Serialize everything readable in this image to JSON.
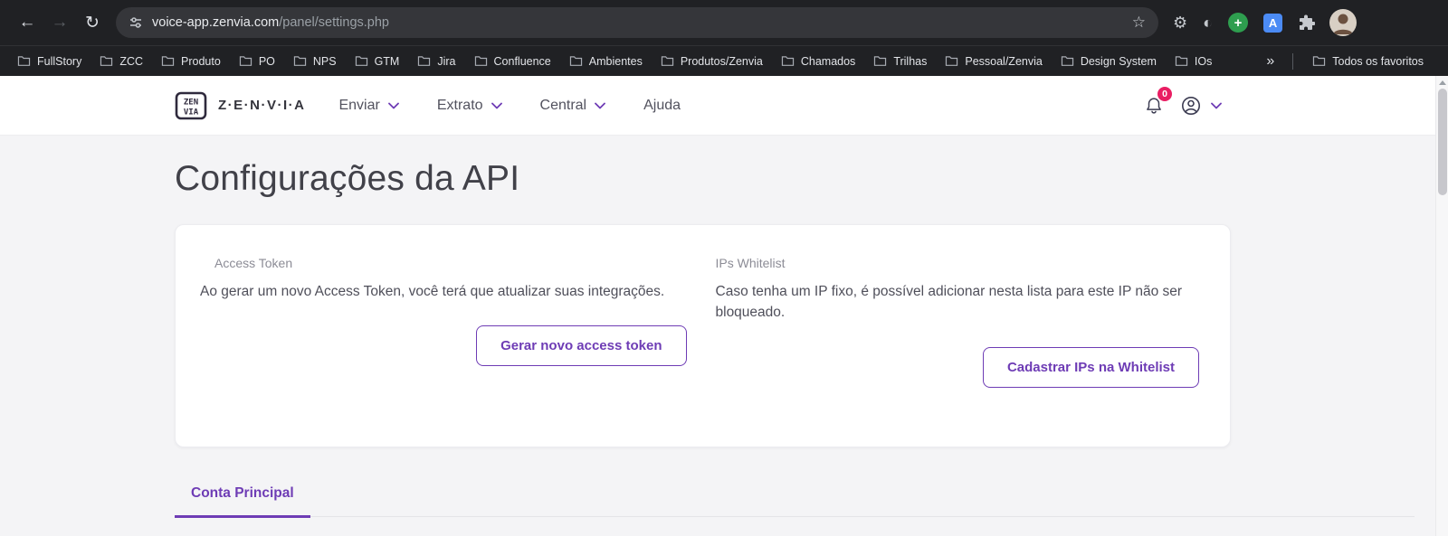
{
  "icons": {
    "back": "←",
    "forward": "→",
    "reload": "↻",
    "star": "☆",
    "gear": "⚙",
    "theme_toggle": "◐",
    "add": "+",
    "translate": "A",
    "overflow": "»"
  },
  "browser": {
    "address": {
      "host": "voice-app.zenvia.com",
      "path": "/panel/settings.php"
    },
    "bookmarks": [
      "FullStory",
      "ZCC",
      "Produto",
      "PO",
      "NPS",
      "GTM",
      "Jira",
      "Confluence",
      "Ambientes",
      "Produtos/Zenvia",
      "Chamados",
      "Trilhas",
      "Pessoal/Zenvia",
      "Design System",
      "IOs"
    ],
    "all_favorites": "Todos os favoritos"
  },
  "header": {
    "brand": "Z·E·N·V·I·A",
    "nav": [
      "Enviar",
      "Extrato",
      "Central",
      "Ajuda"
    ],
    "notification_badge": "0"
  },
  "page": {
    "title": "Configurações da API",
    "access_token": {
      "label": "Access Token",
      "description": "Ao gerar um novo Access Token, você terá que atualizar suas integrações.",
      "button": "Gerar novo access token"
    },
    "ip_whitelist": {
      "label": "IPs Whitelist",
      "description": "Caso tenha um IP fixo, é possível adicionar nesta lista para este IP não ser bloqueado.",
      "button": "Cadastrar IPs na Whitelist"
    },
    "active_tab": "Conta Principal"
  },
  "colors": {
    "accent": "#6e3cb5",
    "badge": "#e91e63",
    "chrome_bg": "#202124",
    "page_bg": "#f4f4f6"
  }
}
